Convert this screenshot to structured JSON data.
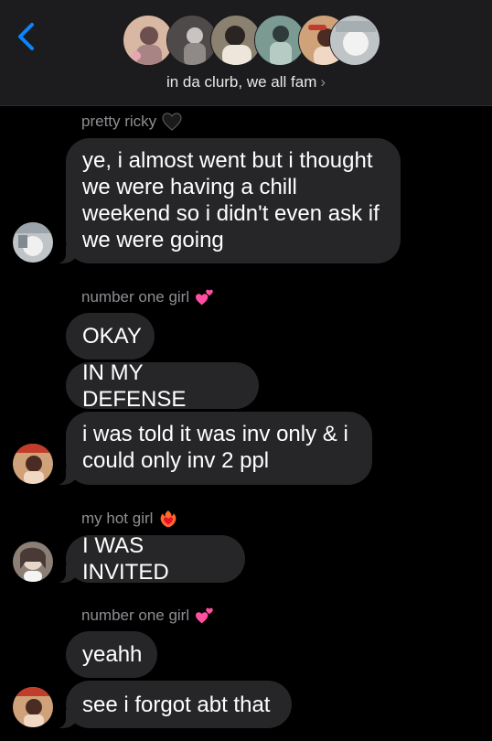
{
  "header": {
    "group_name": "in da clurb, we all fam",
    "chevron": "›",
    "avatars": [
      {
        "name": "avatar-member-1",
        "bg": "#d8b7a3",
        "fg": "#6d4f4f"
      },
      {
        "name": "avatar-member-2",
        "bg": "#4e4a4a",
        "fg": "#c9c4c2"
      },
      {
        "name": "avatar-member-3",
        "bg": "#8a8170",
        "fg": "#eee6da"
      },
      {
        "name": "avatar-member-4",
        "bg": "#7a9a92",
        "fg": "#2f3b3b"
      },
      {
        "name": "avatar-member-5",
        "bg": "#d0a27a",
        "fg": "#4a2c22"
      },
      {
        "name": "avatar-member-6",
        "bg": "#bfc4c6",
        "fg": "#f2f2f2"
      }
    ]
  },
  "colors": {
    "accent": "#0a84ff",
    "bubble": "#262628",
    "background": "#000000",
    "header_bg": "#1c1c1e",
    "sender_text": "#8e8e93"
  },
  "messages": [
    {
      "type": "sender",
      "text": "pretty ricky",
      "icon": "black-heart-icon"
    },
    {
      "type": "bubble",
      "text": "ye, i almost went but i thought we were having a chill weekend so i didn't even ask if we were going"
    },
    {
      "type": "sender",
      "text": "number one girl",
      "icon": "two-hearts-icon"
    },
    {
      "type": "bubble",
      "text": "OKAY"
    },
    {
      "type": "bubble",
      "text": "IN MY DEFENSE"
    },
    {
      "type": "bubble",
      "text": "i was told it was inv only & i could only inv 2 ppl"
    },
    {
      "type": "sender",
      "text": "my hot girl",
      "icon": "heart-on-fire-icon"
    },
    {
      "type": "bubble",
      "text": "I WAS INVITED"
    },
    {
      "type": "sender",
      "text": "number one girl",
      "icon": "two-hearts-icon"
    },
    {
      "type": "bubble",
      "text": "yeahh"
    },
    {
      "type": "bubble",
      "text": "see i forgot abt that"
    }
  ]
}
